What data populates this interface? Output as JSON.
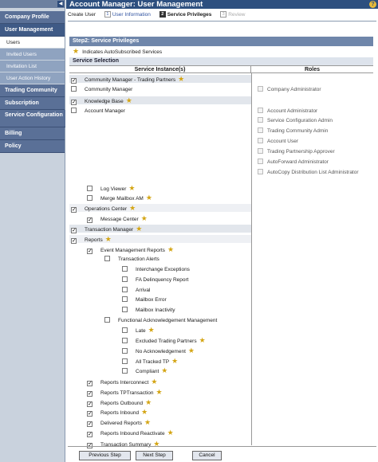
{
  "sidebar": {
    "sections": [
      {
        "label": "Company Profile"
      },
      {
        "label": "User Management"
      },
      {
        "label": "Trading Community"
      },
      {
        "label": "Subscription"
      },
      {
        "label": "Service Configuration"
      },
      {
        "label": "Billing"
      },
      {
        "label": "Policy"
      }
    ],
    "submenu": [
      "Users",
      "Invited Users",
      "Invitation List",
      "User Action History"
    ]
  },
  "title": "Account Manager: User Management",
  "wizard": {
    "steps": [
      {
        "num": "",
        "label": "Create User"
      },
      {
        "num": "1",
        "label": "User Information"
      },
      {
        "num": "2",
        "label": "Service Privileges"
      },
      {
        "num": "3",
        "label": "Review"
      }
    ]
  },
  "step_header": "Step2: Service Privileges",
  "legend": "Indicates AutoSubscribed Services",
  "section_title": "Service Selection",
  "col_service": "Service Instance(s)",
  "col_roles": "Roles",
  "services": [
    {
      "label": "Community Manager - Trading Partners",
      "checked": true,
      "star": true
    },
    {
      "label": "Community Manager",
      "checked": false,
      "star": false
    },
    {
      "label": "Knowledge Base",
      "checked": true,
      "star": true
    },
    {
      "label": "Account Manager",
      "checked": false,
      "star": false
    },
    {
      "label": "Log Viewer",
      "checked": false,
      "star": true
    },
    {
      "label": "Merge Mailbox AM",
      "checked": false,
      "star": true
    },
    {
      "label": "Operations Center",
      "checked": true,
      "star": true
    },
    {
      "label": "Message Center",
      "checked": true,
      "star": true
    },
    {
      "label": "Transaction Manager",
      "checked": true,
      "star": true
    },
    {
      "label": "Reports",
      "checked": true,
      "star": true
    },
    {
      "label": "Event Management Reports",
      "checked": true,
      "star": true
    },
    {
      "label": "Transaction Alerts",
      "checked": false,
      "star": false
    },
    {
      "label": "Interchange Exceptions",
      "checked": false,
      "star": false
    },
    {
      "label": "FA Delinquency Report",
      "checked": false,
      "star": false
    },
    {
      "label": "Arrival",
      "checked": false,
      "star": false
    },
    {
      "label": "Mailbox Error",
      "checked": false,
      "star": false
    },
    {
      "label": "Mailbox Inactivity",
      "checked": false,
      "star": false
    },
    {
      "label": "Functional Acknowledgement Management",
      "checked": false,
      "star": false
    },
    {
      "label": "Late",
      "checked": false,
      "star": true
    },
    {
      "label": "Excluded Trading Partners",
      "checked": false,
      "star": true
    },
    {
      "label": "No Acknowledgement",
      "checked": false,
      "star": true
    },
    {
      "label": "All Tracked TP",
      "checked": false,
      "star": true
    },
    {
      "label": "Compliant",
      "checked": false,
      "star": true
    },
    {
      "label": "Reports Interconnect",
      "checked": true,
      "star": true
    },
    {
      "label": "Reports TPTransaction",
      "checked": true,
      "star": true
    },
    {
      "label": "Reports Outbound",
      "checked": true,
      "star": true
    },
    {
      "label": "Reports Inbound",
      "checked": true,
      "star": true
    },
    {
      "label": "Delivered Reports",
      "checked": true,
      "star": true
    },
    {
      "label": "Reports Inbound Reactivate",
      "checked": true,
      "star": true
    },
    {
      "label": "Transaction Summary",
      "checked": true,
      "star": true
    }
  ],
  "roles": [
    "Company Administrator",
    "Account Administrator",
    "Service Configuration Admin",
    "Trading Community Admin",
    "Account User",
    "Trading Partnership Approver",
    "AutoForward Administrator",
    "AutoCopy Distribution List Administrator"
  ],
  "buttons": {
    "previous": "Previous Step",
    "next": "Next Step",
    "cancel": "Cancel"
  },
  "colors": {
    "title_bar": "#2d4f7f",
    "sidebar_section": "#5a7097",
    "step_bar": "#6f86aa",
    "star": "#d4a514"
  }
}
